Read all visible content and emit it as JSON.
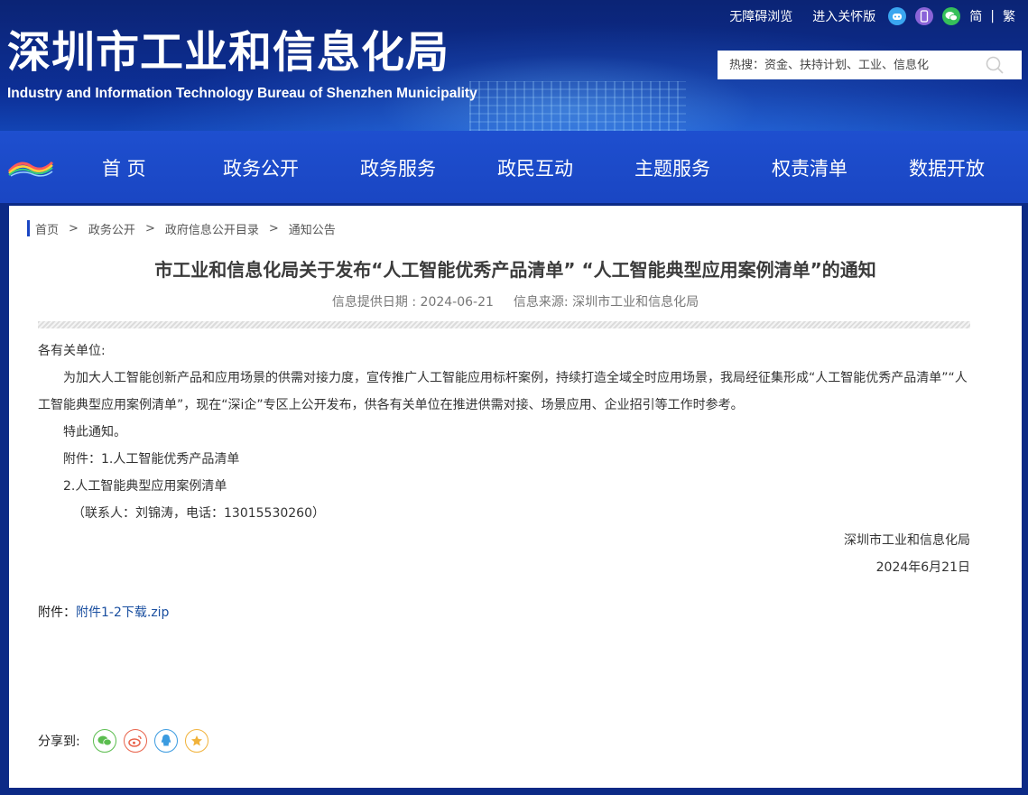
{
  "header": {
    "title": "深圳市工业和信息化局",
    "subtitle": "Industry and Information Technology Bureau of Shenzhen Municipality",
    "top_links": {
      "accessibility": "无障碍浏览",
      "elderly": "进入关怀版",
      "icons": [
        "robot-icon",
        "mobile-icon",
        "wechat-icon"
      ],
      "simplified": "简",
      "separator": "|",
      "traditional": "繁"
    },
    "search": {
      "placeholder": "热搜：资金、扶持计划、工业、信息化",
      "icon": "search-icon"
    }
  },
  "nav": {
    "items": [
      {
        "label": "首 页"
      },
      {
        "label": "政务公开"
      },
      {
        "label": "政务服务"
      },
      {
        "label": "政民互动"
      },
      {
        "label": "主题服务"
      },
      {
        "label": "权责清单"
      },
      {
        "label": "数据开放"
      }
    ]
  },
  "breadcrumb": {
    "items": [
      "首页",
      "政务公开",
      "政府信息公开目录",
      "通知公告"
    ],
    "separator": ">"
  },
  "article": {
    "title": "市工业和信息化局关于发布“人工智能优秀产品清单” “人工智能典型应用案例清单”的通知",
    "date_label": "信息提供日期 : 2024-06-21",
    "source_label": "信息来源:   深圳市工业和信息化局",
    "salutation": "各有关单位:",
    "paragraph": "为加大人工智能创新产品和应用场景的供需对接力度，宣传推广人工智能应用标杆案例，持续打造全域全时应用场景，我局经征集形成“人工智能优秀产品清单”“人工智能典型应用案例清单”，现在“深i企”专区上公开发布，供各有关单位在推进供需对接、场景应用、企业招引等工作时参考。",
    "notice": "特此通知。",
    "attachment_line1": "附件：1.人工智能优秀产品清单",
    "attachment_line2": "2.人工智能典型应用案例清单",
    "contact": "（联系人：刘锦涛，电话：13015530260）",
    "signature": "深圳市工业和信息化局",
    "sign_date": "2024年6月21日"
  },
  "attachments": {
    "label": "附件：",
    "file": "附件1-2下载.zip"
  },
  "share": {
    "label": "分享到:",
    "targets": [
      "wechat-icon",
      "weibo-icon",
      "qq-icon",
      "favorite-icon"
    ]
  },
  "colors": {
    "header_bg": "#0d2f96",
    "nav_bg": "#1a46c3",
    "link": "#1a4fa0"
  }
}
